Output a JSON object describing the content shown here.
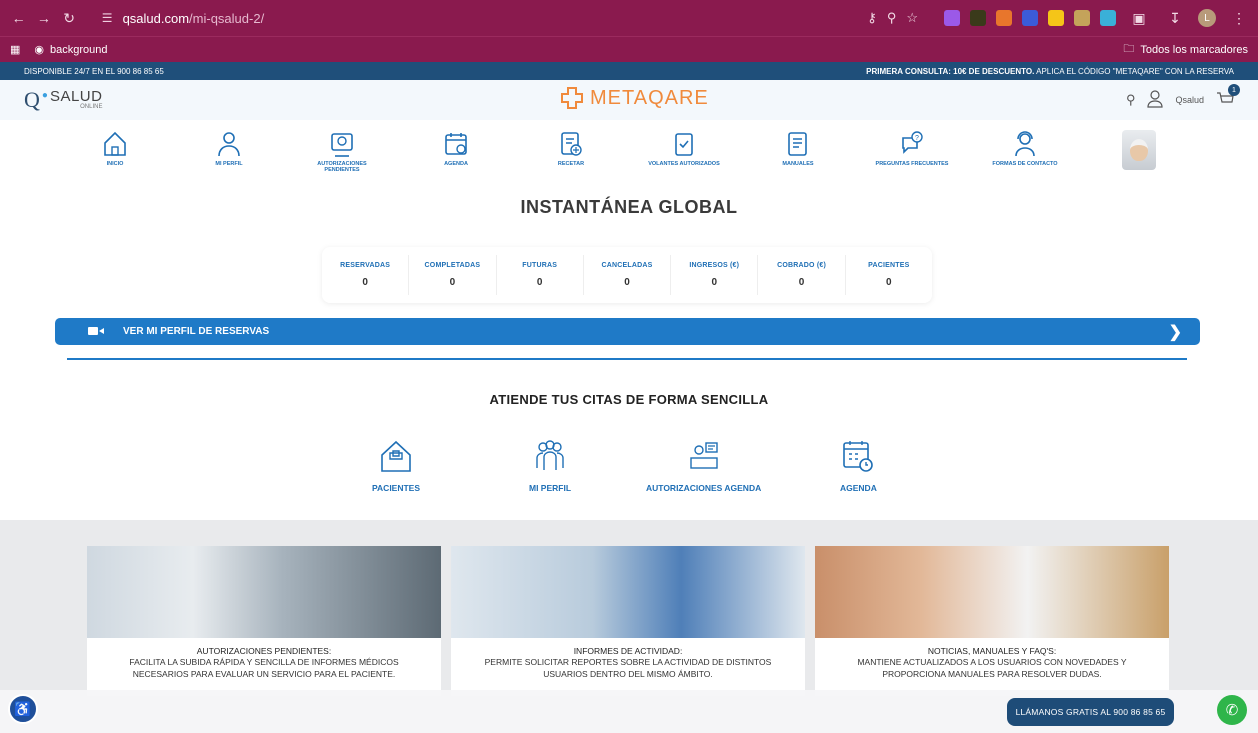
{
  "browser": {
    "url_host": "qsalud.com",
    "url_path": "/mi-qsalud-2/",
    "bookmark_folder": "background",
    "all_bookmarks": "Todos los marcadores",
    "profile_initial": "L"
  },
  "infobar": {
    "left": "DISPONIBLE 24/7 EN EL 900 86 85 65",
    "right_bold": "PRIMERA CONSULTA: 10€ DE DESCUENTO.",
    "right_rest": " APLICA EL CÓDIGO \"METAQARE\" CON LA RESERVA"
  },
  "header": {
    "logo_q": "Q",
    "logo_salud": "SALUD",
    "logo_online": "ONLINE",
    "brand": "METAQARE",
    "user_label": "Qsalud",
    "cart_count": "1"
  },
  "nav": [
    {
      "label": "INICIO"
    },
    {
      "label": "MI PERFIL"
    },
    {
      "label": "AUTORIZACIONES PENDIENTES"
    },
    {
      "label": "AGENDA"
    },
    {
      "label": "RECETAR"
    },
    {
      "label": "VOLANTES AUTORIZADOS"
    },
    {
      "label": "MANUALES"
    },
    {
      "label": "PREGUNTAS FRECUENTES"
    },
    {
      "label": "FORMAS DE CONTACTO"
    }
  ],
  "page_title": "INSTANTÁNEA GLOBAL",
  "stats": [
    {
      "label": "RESERVADAS",
      "value": "0"
    },
    {
      "label": "COMPLETADAS",
      "value": "0"
    },
    {
      "label": "FUTURAS",
      "value": "0"
    },
    {
      "label": "CANCELADAS",
      "value": "0"
    },
    {
      "label": "INGRESOS (€)",
      "value": "0"
    },
    {
      "label": "COBRADO (€)",
      "value": "0"
    },
    {
      "label": "PACIENTES",
      "value": "0"
    }
  ],
  "profile_bar": "VER MI PERFIL DE RESERVAS",
  "subtitle": "ATIENDE TUS CITAS DE FORMA SENCILLA",
  "actions": [
    {
      "label": "PACIENTES"
    },
    {
      "label": "MI PERFIL"
    },
    {
      "label": "AUTORIZACIONES AGENDA"
    },
    {
      "label": "AGENDA"
    }
  ],
  "cards": [
    {
      "title": "AUTORIZACIONES PENDIENTES:",
      "desc": "FACILITA LA SUBIDA RÁPIDA Y SENCILLA DE INFORMES MÉDICOS NECESARIOS PARA EVALUAR UN SERVICIO PARA EL PACIENTE."
    },
    {
      "title": "INFORMES DE ACTIVIDAD:",
      "desc": "PERMITE SOLICITAR REPORTES SOBRE LA ACTIVIDAD DE DISTINTOS USUARIOS DENTRO DEL MISMO ÁMBITO."
    },
    {
      "title": "NOTICIAS, MANUALES Y FAQ'S:",
      "desc": "MANTIENE ACTUALIZADOS A LOS USUARIOS CON NOVEDADES Y PROPORCIONA MANUALES PARA RESOLVER DUDAS."
    }
  ],
  "call_button": "LLÁMANOS GRATIS AL 900 86 85 65",
  "colors": {
    "chrome": "#8a1a4e",
    "primary_blue": "#1f7ac7",
    "brand_orange": "#f08a3c"
  }
}
